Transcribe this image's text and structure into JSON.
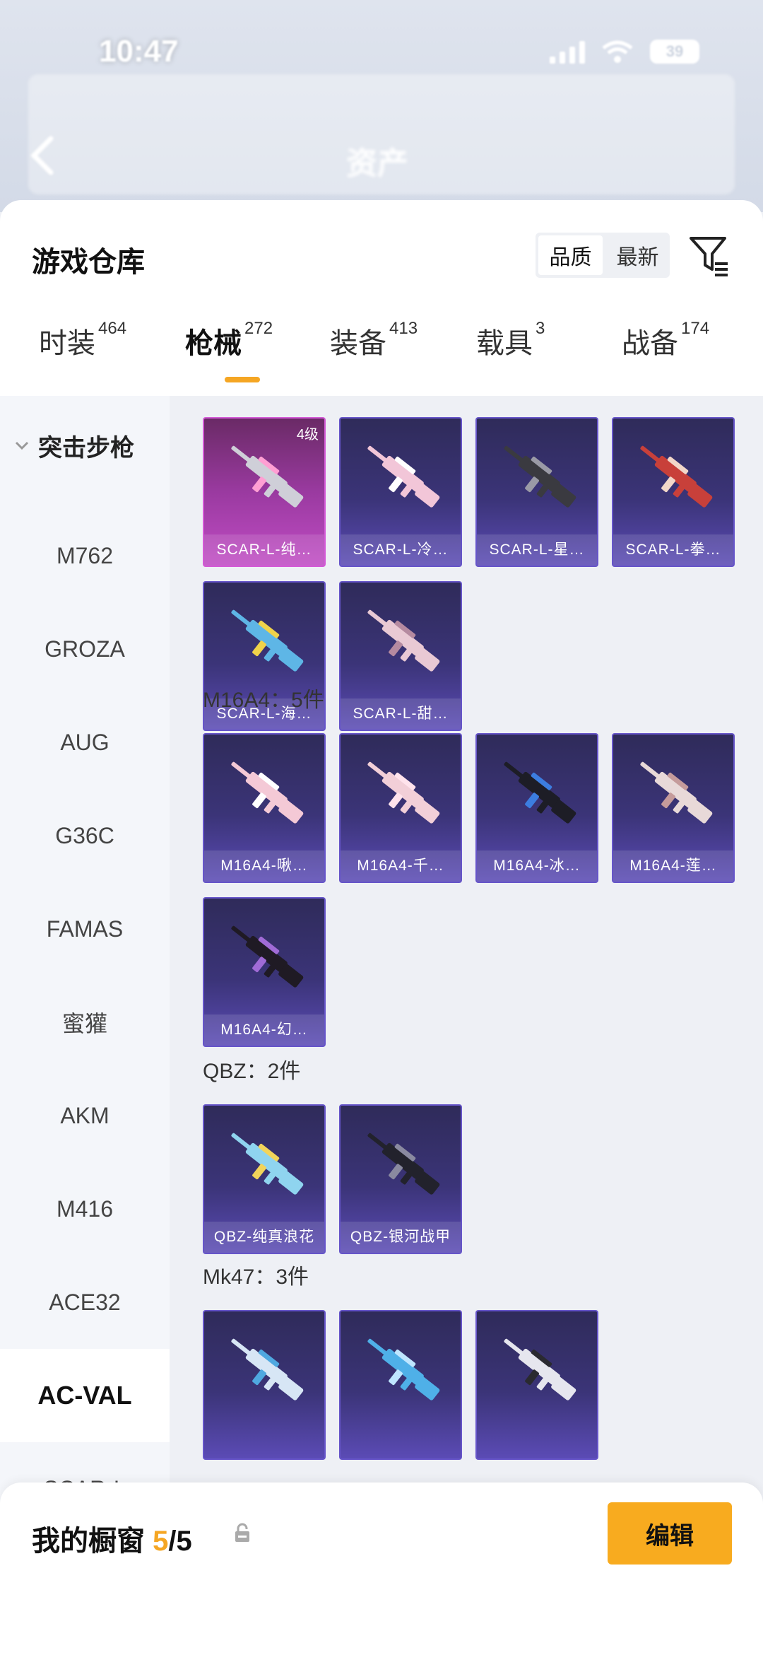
{
  "status_bar": {
    "time": "10:47",
    "battery": "39"
  },
  "header": {
    "title": "资产"
  },
  "sheet": {
    "title": "游戏仓库",
    "sort": {
      "quality": "品质",
      "newest": "最新"
    }
  },
  "tabs": [
    {
      "label": "时装",
      "count": "464"
    },
    {
      "label": "枪械",
      "count": "272"
    },
    {
      "label": "装备",
      "count": "413"
    },
    {
      "label": "载具",
      "count": "3"
    },
    {
      "label": "战备",
      "count": "174"
    }
  ],
  "sidebar": {
    "group": "突击步枪",
    "items": [
      "M762",
      "GROZA",
      "AUG",
      "G36C",
      "FAMAS",
      "蜜獾",
      "AKM",
      "M416",
      "ACE32",
      "AC-VAL",
      "SCAR-L"
    ]
  },
  "sections": {
    "scar": {
      "cards": [
        {
          "caption": "SCAR-L-纯…",
          "grade": "4级",
          "style": "purple",
          "gun": "#cfcfd8",
          "accent": "#ff9fd3"
        },
        {
          "caption": "SCAR-L-冷…",
          "style": "blue",
          "gun": "#f2c6d8",
          "accent": "#ffffff"
        },
        {
          "caption": "SCAR-L-星…",
          "style": "blue",
          "gun": "#3a3a40",
          "accent": "#9a9aa6"
        },
        {
          "caption": "SCAR-L-拳…",
          "style": "blue",
          "gun": "#c8403a",
          "accent": "#f2d7c9"
        },
        {
          "caption": "SCAR-L-海…",
          "style": "blue",
          "gun": "#5eb6e6",
          "accent": "#f0d24a"
        },
        {
          "caption": "SCAR-L-甜…",
          "style": "blue",
          "gun": "#e9c9d4",
          "accent": "#b58aa0"
        }
      ]
    },
    "m16": {
      "label": "M16A4：5件",
      "cards": [
        {
          "caption": "M16A4-啾…",
          "style": "blue",
          "gun": "#f4c9d6",
          "accent": "#ffffff"
        },
        {
          "caption": "M16A4-千…",
          "style": "blue",
          "gun": "#f2cfd8",
          "accent": "#ffe3ec"
        },
        {
          "caption": "M16A4-冰…",
          "style": "blue",
          "gun": "#1d1d26",
          "accent": "#3c7de0"
        },
        {
          "caption": "M16A4-莲…",
          "style": "blue",
          "gun": "#e8d9d8",
          "accent": "#c59b9b"
        },
        {
          "caption": "M16A4-幻…",
          "style": "blue",
          "gun": "#1f1a24",
          "accent": "#a06bd6"
        }
      ]
    },
    "qbz": {
      "label": "QBZ：2件",
      "cards": [
        {
          "caption": "QBZ-纯真浪花",
          "style": "blue",
          "gun": "#8fd4ef",
          "accent": "#f2d45a"
        },
        {
          "caption": "QBZ-银河战甲",
          "style": "blue",
          "gun": "#22222c",
          "accent": "#8a8aa0"
        }
      ]
    },
    "mk47": {
      "label": "Mk47：3件",
      "cards": [
        {
          "caption": "",
          "style": "blue",
          "gun": "#d7e6f5",
          "accent": "#4fa8e0"
        },
        {
          "caption": "",
          "style": "blue",
          "gun": "#4fb0e8",
          "accent": "#bfe6ff"
        },
        {
          "caption": "",
          "style": "blue",
          "gun": "#e6e6ee",
          "accent": "#2a2a30"
        }
      ]
    }
  },
  "bottom": {
    "showcase_label": "我的橱窗",
    "showcase_current": "5",
    "showcase_total": "/5",
    "edit_label": "编辑"
  },
  "colors": {
    "accent": "#f5a623",
    "card_border": "#6655c9",
    "rare_border": "#d35ad6"
  }
}
